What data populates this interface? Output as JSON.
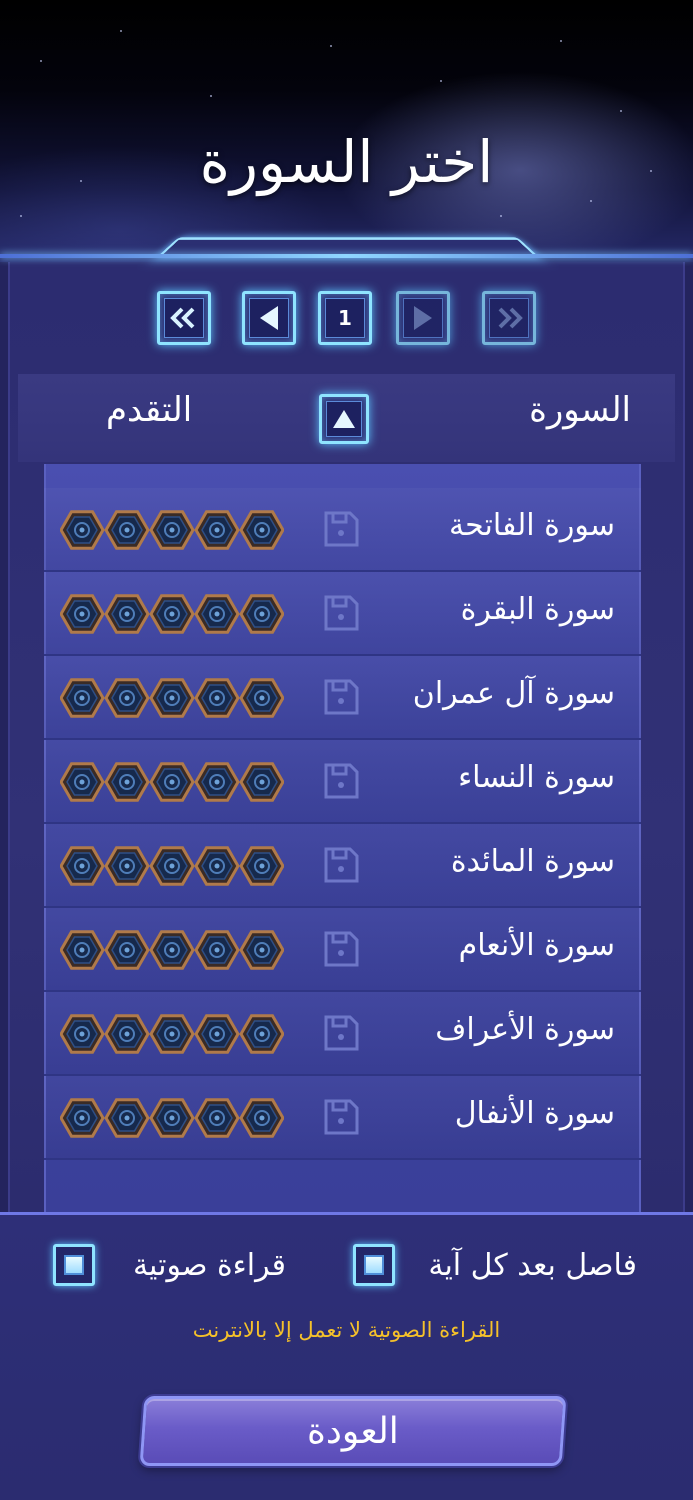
{
  "screen": {
    "title": "اختر السورة"
  },
  "pager": {
    "first_icon": "double-chevron-left-icon",
    "prev_icon": "triangle-left-icon",
    "page": "1",
    "next_icon": "triangle-right-icon",
    "last_icon": "double-chevron-right-icon"
  },
  "columns": {
    "surah": "السورة",
    "progress": "التقدم",
    "sort_icon": "triangle-up-icon"
  },
  "surahs": [
    {
      "name": "سورة الفاتحة",
      "stars": 0,
      "max_stars": 5
    },
    {
      "name": "سورة البقرة",
      "stars": 0,
      "max_stars": 5
    },
    {
      "name": "سورة آل عمران",
      "stars": 0,
      "max_stars": 5
    },
    {
      "name": "سورة النساء",
      "stars": 0,
      "max_stars": 5
    },
    {
      "name": "سورة المائدة",
      "stars": 0,
      "max_stars": 5
    },
    {
      "name": "سورة الأنعام",
      "stars": 0,
      "max_stars": 5
    },
    {
      "name": "سورة الأعراف",
      "stars": 0,
      "max_stars": 5
    },
    {
      "name": "سورة الأنفال",
      "stars": 0,
      "max_stars": 5
    }
  ],
  "options": {
    "separator_label": "فاصل بعد كل آية",
    "separator_checked": true,
    "audio_label": "قراءة صوتية",
    "audio_checked": true
  },
  "warning": "القراءة الصوتية لا تعمل إلا بالانترنت",
  "back_label": "العودة",
  "colors": {
    "accent": "#8fe4ff",
    "warning": "#f5c12a",
    "panel": "#2c2c70",
    "list": "#4a4fb0"
  }
}
